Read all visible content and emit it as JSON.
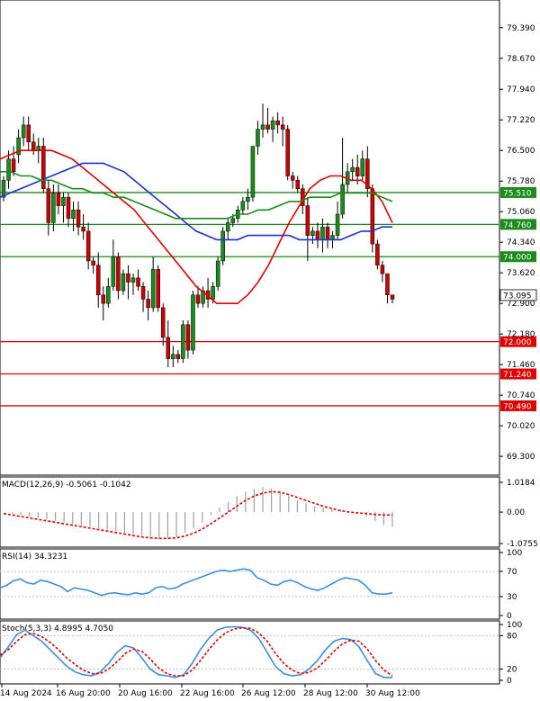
{
  "chart_data": {
    "type": "candlestick",
    "main": {
      "y_ticks": [
        "79.390",
        "78.670",
        "77.940",
        "77.220",
        "76.500",
        "75.780",
        "75.060",
        "74.340",
        "73.620",
        "72.900",
        "72.180",
        "71.460",
        "70.740",
        "70.020",
        "69.300"
      ],
      "ylim": [
        68.9,
        80.0
      ],
      "candles": [
        [
          75.4,
          75.9,
          75.3,
          75.8
        ],
        [
          75.8,
          76.5,
          75.6,
          76.3
        ],
        [
          76.3,
          76.6,
          75.9,
          76.0
        ],
        [
          76.4,
          77.0,
          76.2,
          76.8
        ],
        [
          76.8,
          77.3,
          76.6,
          77.1
        ],
        [
          77.1,
          77.3,
          76.5,
          76.7
        ],
        [
          76.7,
          76.9,
          76.4,
          76.5
        ],
        [
          76.5,
          76.8,
          76.2,
          76.6
        ],
        [
          76.6,
          76.8,
          75.5,
          75.6
        ],
        [
          75.6,
          75.8,
          74.5,
          74.8
        ],
        [
          74.8,
          75.7,
          74.6,
          75.5
        ],
        [
          75.5,
          75.7,
          75.0,
          75.2
        ],
        [
          75.2,
          75.5,
          74.8,
          75.4
        ],
        [
          75.4,
          75.5,
          74.7,
          74.9
        ],
        [
          74.9,
          75.3,
          74.6,
          75.1
        ],
        [
          75.1,
          75.3,
          74.5,
          74.7
        ],
        [
          74.7,
          75.0,
          74.4,
          74.6
        ],
        [
          74.6,
          74.8,
          73.7,
          73.9
        ],
        [
          73.9,
          74.0,
          73.6,
          73.8
        ],
        [
          73.8,
          74.1,
          72.8,
          73.1
        ],
        [
          73.1,
          73.3,
          72.5,
          72.9
        ],
        [
          72.9,
          73.5,
          72.8,
          73.3
        ],
        [
          73.3,
          74.4,
          73.2,
          74.0
        ],
        [
          74.0,
          74.1,
          73.0,
          73.2
        ],
        [
          73.2,
          73.7,
          73.1,
          73.6
        ],
        [
          73.6,
          73.8,
          73.0,
          73.4
        ],
        [
          73.4,
          73.6,
          73.1,
          73.5
        ],
        [
          73.5,
          73.7,
          73.2,
          73.3
        ],
        [
          73.3,
          73.4,
          72.7,
          73.0
        ],
        [
          73.0,
          73.2,
          72.5,
          72.8
        ],
        [
          72.8,
          74.0,
          72.7,
          73.7
        ],
        [
          73.7,
          73.8,
          72.7,
          72.8
        ],
        [
          72.8,
          72.9,
          71.9,
          72.1
        ],
        [
          72.1,
          72.5,
          71.4,
          71.6
        ],
        [
          71.6,
          71.9,
          71.4,
          71.7
        ],
        [
          71.7,
          71.8,
          71.5,
          71.6
        ],
        [
          71.6,
          72.5,
          71.5,
          72.4
        ],
        [
          72.4,
          72.5,
          71.6,
          71.8
        ],
        [
          71.8,
          73.2,
          71.7,
          73.1
        ],
        [
          73.1,
          73.3,
          72.8,
          72.9
        ],
        [
          72.9,
          73.3,
          72.8,
          73.2
        ],
        [
          73.2,
          73.5,
          72.8,
          73.0
        ],
        [
          73.0,
          73.4,
          72.9,
          73.3
        ],
        [
          73.3,
          74.0,
          73.2,
          73.9
        ],
        [
          73.9,
          74.7,
          73.8,
          74.6
        ],
        [
          74.6,
          74.9,
          74.4,
          74.8
        ],
        [
          74.8,
          75.0,
          74.7,
          74.9
        ],
        [
          74.9,
          75.2,
          74.8,
          75.1
        ],
        [
          75.1,
          75.4,
          75.0,
          75.3
        ],
        [
          75.3,
          75.6,
          75.1,
          75.4
        ],
        [
          75.4,
          76.6,
          75.3,
          76.6
        ],
        [
          76.6,
          77.2,
          76.4,
          77.0
        ],
        [
          77.0,
          77.6,
          76.8,
          77.1
        ],
        [
          77.1,
          77.5,
          76.9,
          77.0
        ],
        [
          77.0,
          77.3,
          76.7,
          77.2
        ],
        [
          77.2,
          77.4,
          76.9,
          77.1
        ],
        [
          77.1,
          77.3,
          76.6,
          77.0
        ],
        [
          77.0,
          77.1,
          75.8,
          75.9
        ],
        [
          75.9,
          76.0,
          75.6,
          75.8
        ],
        [
          75.8,
          75.9,
          75.5,
          75.6
        ],
        [
          75.6,
          75.7,
          75.0,
          75.2
        ],
        [
          75.2,
          75.4,
          73.9,
          74.5
        ],
        [
          74.5,
          74.7,
          74.3,
          74.6
        ],
        [
          74.6,
          74.8,
          74.2,
          74.4
        ],
        [
          74.4,
          74.9,
          74.1,
          74.7
        ],
        [
          74.7,
          74.8,
          74.2,
          74.4
        ],
        [
          74.4,
          74.6,
          74.2,
          74.5
        ],
        [
          74.5,
          75.3,
          74.4,
          75.0
        ],
        [
          75.0,
          76.8,
          74.9,
          75.7
        ],
        [
          75.7,
          76.2,
          75.5,
          76.0
        ],
        [
          76.0,
          76.3,
          75.8,
          76.1
        ],
        [
          76.1,
          76.4,
          75.7,
          75.9
        ],
        [
          75.9,
          76.5,
          75.8,
          76.3
        ],
        [
          76.3,
          76.6,
          75.4,
          75.6
        ],
        [
          75.6,
          75.7,
          74.1,
          74.3
        ],
        [
          74.3,
          74.4,
          73.7,
          73.8
        ],
        [
          73.8,
          73.9,
          73.4,
          73.6
        ],
        [
          73.6,
          73.6,
          72.9,
          73.1
        ],
        [
          73.1,
          73.1,
          72.9,
          73.0
        ]
      ],
      "ma_red": [
        76.3,
        76.4,
        76.5,
        76.5,
        76.5,
        76.5,
        76.4,
        76.3,
        76.1,
        75.9,
        75.7,
        75.5,
        75.3,
        75.1,
        74.8,
        74.5,
        74.2,
        73.9,
        73.6,
        73.3,
        73.1,
        72.9,
        72.9,
        72.9,
        73.1,
        73.4,
        73.8,
        74.3,
        74.8,
        75.2,
        75.6,
        75.8,
        75.9,
        75.9,
        75.8,
        75.8,
        75.6,
        75.3,
        74.8
      ],
      "ma_blue": [
        75.4,
        75.5,
        75.6,
        75.7,
        75.8,
        75.9,
        76.0,
        76.1,
        76.2,
        76.2,
        76.2,
        76.1,
        76.0,
        75.8,
        75.6,
        75.4,
        75.2,
        75.0,
        74.8,
        74.6,
        74.5,
        74.4,
        74.4,
        74.4,
        74.5,
        74.5,
        74.5,
        74.5,
        74.5,
        74.4,
        74.4,
        74.4,
        74.4,
        74.4,
        74.5,
        74.6,
        74.6,
        74.7,
        74.7
      ],
      "ma_green": [
        76.0,
        76.0,
        75.9,
        75.9,
        75.8,
        75.8,
        75.7,
        75.6,
        75.6,
        75.5,
        75.5,
        75.4,
        75.4,
        75.3,
        75.2,
        75.1,
        75.0,
        74.9,
        74.9,
        74.9,
        74.9,
        74.9,
        74.9,
        75.0,
        75.0,
        75.1,
        75.1,
        75.2,
        75.3,
        75.3,
        75.4,
        75.4,
        75.4,
        75.5,
        75.5,
        75.5,
        75.5,
        75.4,
        75.3
      ],
      "hlines": [
        {
          "value": 75.51,
          "label": "75.510",
          "color": "#1a8c1a"
        },
        {
          "value": 74.76,
          "label": "74.760",
          "color": "#1a8c1a"
        },
        {
          "value": 74.0,
          "label": "74.000",
          "color": "#1a8c1a"
        },
        {
          "value": 72.0,
          "label": "72.000",
          "color": "#e00000"
        },
        {
          "value": 71.24,
          "label": "71.240",
          "color": "#e00000"
        },
        {
          "value": 70.49,
          "label": "70.490",
          "color": "#e00000"
        }
      ],
      "last_price": {
        "value": 73.095,
        "label": "73.095"
      }
    },
    "macd": {
      "title": "MACD(12,26,9) -0.5061 -0.1042",
      "y_ticks": [
        "1.0184",
        "0.00",
        "-1.0755"
      ],
      "ylim": [
        -1.0755,
        1.0184
      ],
      "histogram": [
        0.0,
        -0.05,
        -0.1,
        -0.15,
        -0.2,
        -0.25,
        -0.3,
        -0.35,
        -0.4,
        -0.45,
        -0.5,
        -0.55,
        -0.6,
        -0.65,
        -0.7,
        -0.75,
        -0.8,
        -0.85,
        -0.88,
        -0.9,
        -0.85,
        -0.7,
        -0.55,
        -0.35,
        -0.1,
        0.15,
        0.35,
        0.55,
        0.7,
        0.8,
        0.85,
        0.8,
        0.7,
        0.55,
        0.4,
        0.3,
        0.2,
        0.15,
        0.1,
        0.05,
        0.0,
        -0.05,
        -0.15,
        -0.3,
        -0.45,
        -0.5
      ],
      "signal": [
        -0.05,
        -0.1,
        -0.15,
        -0.2,
        -0.25,
        -0.3,
        -0.35,
        -0.4,
        -0.45,
        -0.5,
        -0.55,
        -0.6,
        -0.65,
        -0.7,
        -0.75,
        -0.8,
        -0.85,
        -0.88,
        -0.9,
        -0.9,
        -0.88,
        -0.82,
        -0.72,
        -0.58,
        -0.4,
        -0.2,
        0.0,
        0.2,
        0.4,
        0.55,
        0.65,
        0.7,
        0.68,
        0.6,
        0.5,
        0.4,
        0.3,
        0.2,
        0.12,
        0.05,
        0.0,
        -0.03,
        -0.05,
        -0.08,
        -0.1,
        -0.1
      ]
    },
    "rsi": {
      "title": "RSI(14) 34.3231",
      "y_ticks": [
        "100",
        "70",
        "30",
        "0"
      ],
      "ylim": [
        0,
        100
      ],
      "values": [
        44,
        48,
        55,
        58,
        52,
        50,
        56,
        54,
        50,
        46,
        38,
        44,
        42,
        40,
        36,
        32,
        35,
        36,
        34,
        33,
        36,
        34,
        36,
        44,
        46,
        42,
        44,
        50,
        54,
        58,
        62,
        66,
        70,
        72,
        70,
        72,
        74,
        72,
        60,
        56,
        50,
        48,
        54,
        56,
        52,
        46,
        42,
        40,
        44,
        50,
        56,
        60,
        58,
        56,
        48,
        36,
        34,
        34,
        36
      ]
    },
    "stoch": {
      "title": "Stoch(5,3,3) 4.8995 4.7050",
      "y_ticks": [
        "100",
        "80",
        "20",
        "0"
      ],
      "ylim": [
        0,
        100
      ],
      "main": [
        40,
        60,
        82,
        90,
        80,
        70,
        55,
        40,
        25,
        15,
        10,
        8,
        15,
        30,
        50,
        62,
        58,
        40,
        20,
        10,
        8,
        5,
        10,
        30,
        55,
        75,
        90,
        95,
        96,
        95,
        90,
        75,
        50,
        25,
        12,
        8,
        10,
        20,
        35,
        55,
        70,
        75,
        73,
        60,
        35,
        12,
        5,
        5
      ],
      "signal": [
        45,
        55,
        70,
        82,
        84,
        78,
        68,
        55,
        40,
        28,
        18,
        12,
        12,
        20,
        33,
        48,
        56,
        52,
        38,
        22,
        12,
        8,
        8,
        18,
        35,
        55,
        72,
        85,
        92,
        94,
        93,
        85,
        70,
        48,
        30,
        18,
        12,
        14,
        22,
        36,
        52,
        65,
        72,
        70,
        56,
        35,
        18,
        8
      ]
    },
    "x_labels": [
      "14 Aug 2024",
      "16 Aug 20:00",
      "20 Aug 16:00",
      "22 Aug 16:00",
      "26 Aug 12:00",
      "28 Aug 12:00",
      "30 Aug 12:00"
    ]
  }
}
